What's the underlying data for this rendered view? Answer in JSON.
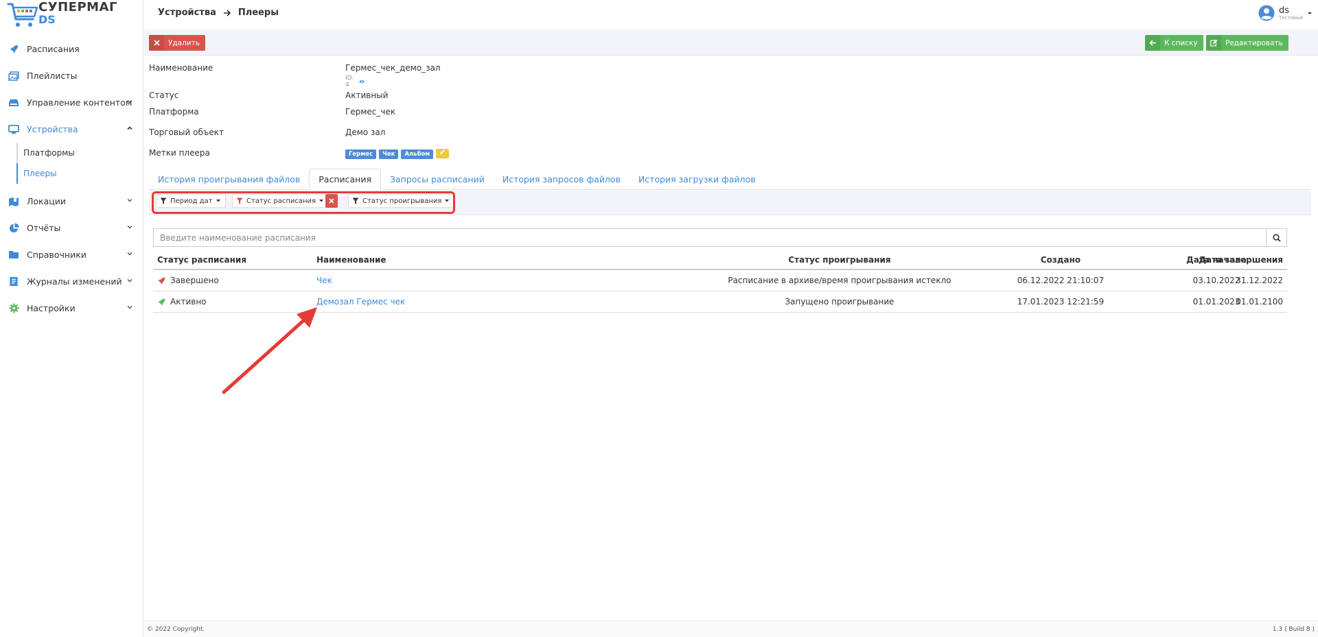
{
  "app": {
    "logo_line1": "СУПЕРМАГ",
    "logo_line2": "DS"
  },
  "sidebar": {
    "items": [
      {
        "label": "Расписания",
        "icon": "rocket-icon"
      },
      {
        "label": "Плейлисты",
        "icon": "images-icon"
      },
      {
        "label": "Управление контентом",
        "icon": "hdd-icon"
      },
      {
        "label": "Устройства",
        "icon": "monitor-icon"
      },
      {
        "label": "Локации",
        "icon": "map-icon"
      },
      {
        "label": "Отчёты",
        "icon": "pie-chart-icon"
      },
      {
        "label": "Справочники",
        "icon": "folder-icon"
      },
      {
        "label": "Журналы изменений",
        "icon": "journal-icon"
      },
      {
        "label": "Настройки",
        "icon": "gear-icon"
      }
    ],
    "subitems": [
      {
        "label": "Платформы"
      },
      {
        "label": "Плееры"
      }
    ]
  },
  "header": {
    "crumb1": "Устройства",
    "crumb2": "Плееры",
    "user_name": "ds",
    "user_role": "Тестовый"
  },
  "toolbar": {
    "delete_label": "Удалить",
    "back_label": "К списку",
    "edit_label": "Редактировать"
  },
  "details": {
    "name_label": "Наименование",
    "name_value": "Гермес_чек_демо_зал",
    "id_text": "ID: 4",
    "status_label": "Статус",
    "status_value": "Активный",
    "platform_label": "Платформа",
    "platform_value": "Гермес_чек",
    "object_label": "Торговый объект",
    "object_value": "Демо зал",
    "tags_label": "Метки плеера",
    "tags": [
      "Гермес",
      "Чек",
      "Альбом"
    ]
  },
  "tabs": [
    "История проигрывания файлов",
    "Расписания",
    "Запросы расписаний",
    "История запросов файлов",
    "История загрузки файлов"
  ],
  "filters": {
    "date_period": "Период дат",
    "schedule_status": "Статус расписания",
    "play_status": "Статус проигрывания"
  },
  "search": {
    "placeholder": "Введите наименование расписания"
  },
  "table": {
    "headers": [
      "Статус расписания",
      "Наименование",
      "Статус проигрывания",
      "Создано",
      "Дата начала",
      "Дата завершения"
    ],
    "rows": [
      {
        "status": "Завершено",
        "status_color": "#d9534f",
        "name": "Чек",
        "play_status": "Расписание в архиве/время проигрывания истекло",
        "created": "06.12.2022 21:10:07",
        "start": "03.10.2022",
        "end": "31.12.2022"
      },
      {
        "status": "Активно",
        "status_color": "#5cb85c",
        "name": "Демозал Гермес чек",
        "play_status": "Запущено проигрывание",
        "created": "17.01.2023 12:21:59",
        "start": "01.01.2023",
        "end": "01.01.2100"
      }
    ]
  },
  "footer": {
    "copyright": "© 2022 Copyright.",
    "version": "1.3 ( Build 8 )"
  },
  "colors": {
    "accent": "#3f8ad8",
    "highlight": "#e53b36"
  }
}
